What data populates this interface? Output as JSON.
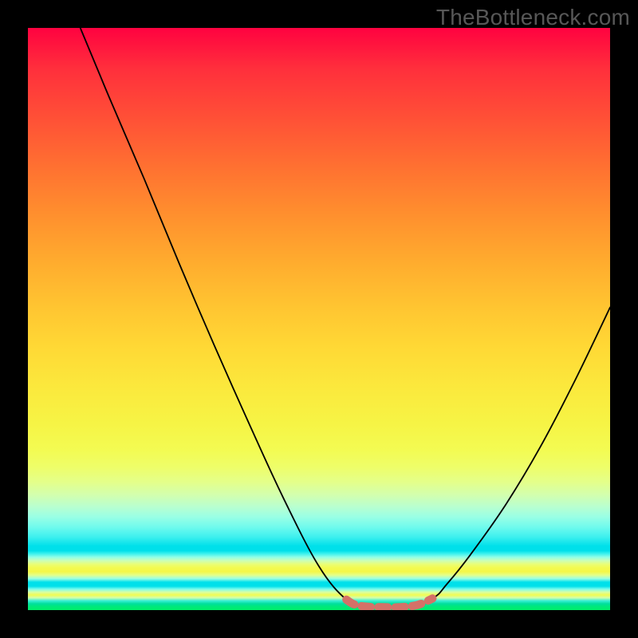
{
  "watermark": "TheBottleneck.com",
  "chart_data": {
    "type": "line",
    "title": "",
    "xlabel": "",
    "ylabel": "",
    "xlim": [
      0,
      100
    ],
    "ylim": [
      0,
      100
    ],
    "grid": false,
    "legend": false,
    "note": "Axis values are normalized 0..100 estimated from the plot area; y=100 is top, y=0 is bottom.",
    "series": [
      {
        "name": "main-curve",
        "color": "#000000",
        "x": [
          9.0,
          14.0,
          20.0,
          26.0,
          32.0,
          38.0,
          44.0,
          50.0,
          54.7,
          58.0,
          65.0,
          69.5,
          72.0,
          76.0,
          82.0,
          88.0,
          94.0,
          100.0
        ],
        "y": [
          100.0,
          88.0,
          74.0,
          59.5,
          45.5,
          32.0,
          19.0,
          7.5,
          1.8,
          0.6,
          0.6,
          2.0,
          4.5,
          9.5,
          18.0,
          28.0,
          39.5,
          52.0
        ]
      },
      {
        "name": "valley-highlight",
        "color": "#d47168",
        "x": [
          54.7,
          56.0,
          58.0,
          61.0,
          64.0,
          67.0,
          69.5
        ],
        "y": [
          1.8,
          1.0,
          0.6,
          0.5,
          0.5,
          0.9,
          2.0
        ]
      }
    ],
    "background_gradient": {
      "orientation": "vertical",
      "stops": [
        {
          "pos": 0.0,
          "color": "#ff0240"
        },
        {
          "pos": 0.35,
          "color": "#ff9a2e"
        },
        {
          "pos": 0.62,
          "color": "#fbe93d"
        },
        {
          "pos": 0.78,
          "color": "#e4ff8a"
        },
        {
          "pos": 0.89,
          "color": "#00e0ea"
        },
        {
          "pos": 0.935,
          "color": "#f4f747"
        },
        {
          "pos": 0.952,
          "color": "#00e0ea"
        },
        {
          "pos": 0.974,
          "color": "#f2fc52"
        },
        {
          "pos": 0.989,
          "color": "#00df9e"
        },
        {
          "pos": 1.0,
          "color": "#00ee6a"
        }
      ]
    }
  }
}
